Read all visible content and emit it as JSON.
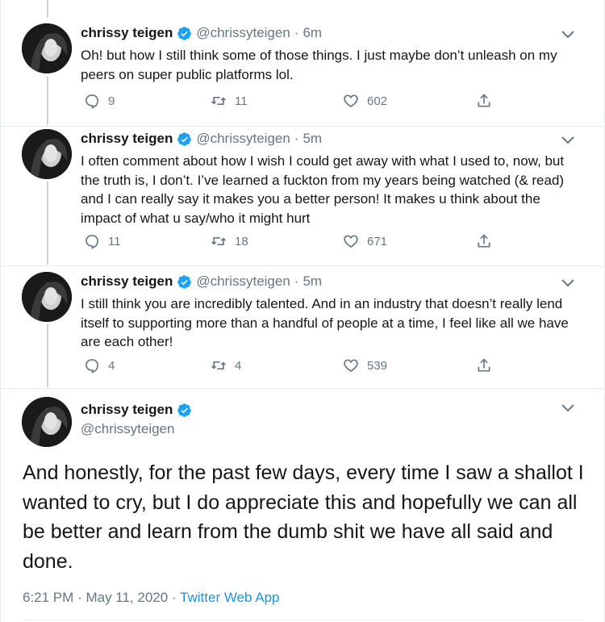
{
  "colors": {
    "verified_blue": "#1da1f2",
    "link_blue": "#1b95e0",
    "secondary_text": "#657786",
    "primary_text": "#14171a"
  },
  "tweets": [
    {
      "name": "chrissy teigen",
      "handle": "@chrissyteigen",
      "separator": "·",
      "time": "6m",
      "text": "Oh! but how I still think some of those things. I just maybe don’t unleash on my peers on super public platforms lol.",
      "replies": "9",
      "retweets": "11",
      "likes": "602"
    },
    {
      "name": "chrissy teigen",
      "handle": "@chrissyteigen",
      "separator": "·",
      "time": "5m",
      "text": "I often comment about how I wish I could get away with what I used to, now, but the truth is, I don’t. I’ve learned a fuckton from my years being watched (& read) and I can really say it makes you a better person!  It makes u think about the impact of what u say/who it might hurt",
      "replies": "11",
      "retweets": "18",
      "likes": "671"
    },
    {
      "name": "chrissy teigen",
      "handle": "@chrissyteigen",
      "separator": "·",
      "time": "5m",
      "text": "I still think you are incredibly talented. And in an industry that doesn’t really lend itself to supporting more than a handful of people at a time, I feel like all we have are each other!",
      "replies": "4",
      "retweets": "4",
      "likes": "539"
    }
  ],
  "main_tweet": {
    "name": "chrissy teigen",
    "handle": "@chrissyteigen",
    "text": "And honestly, for the past few days, every time I saw a shallot I wanted to cry, but I do appreciate this and hopefully we can all be better and learn from the dumb shit we have all said and done.",
    "time": "6:21 PM",
    "separator": "·",
    "date": "May 11, 2020",
    "app": "Twitter Web App"
  },
  "icons": {
    "verified": "verified-badge-icon",
    "reply": "reply-icon",
    "retweet": "retweet-icon",
    "like": "like-icon",
    "share": "share-icon",
    "more": "chevron-down-icon",
    "avatar": "avatar"
  }
}
